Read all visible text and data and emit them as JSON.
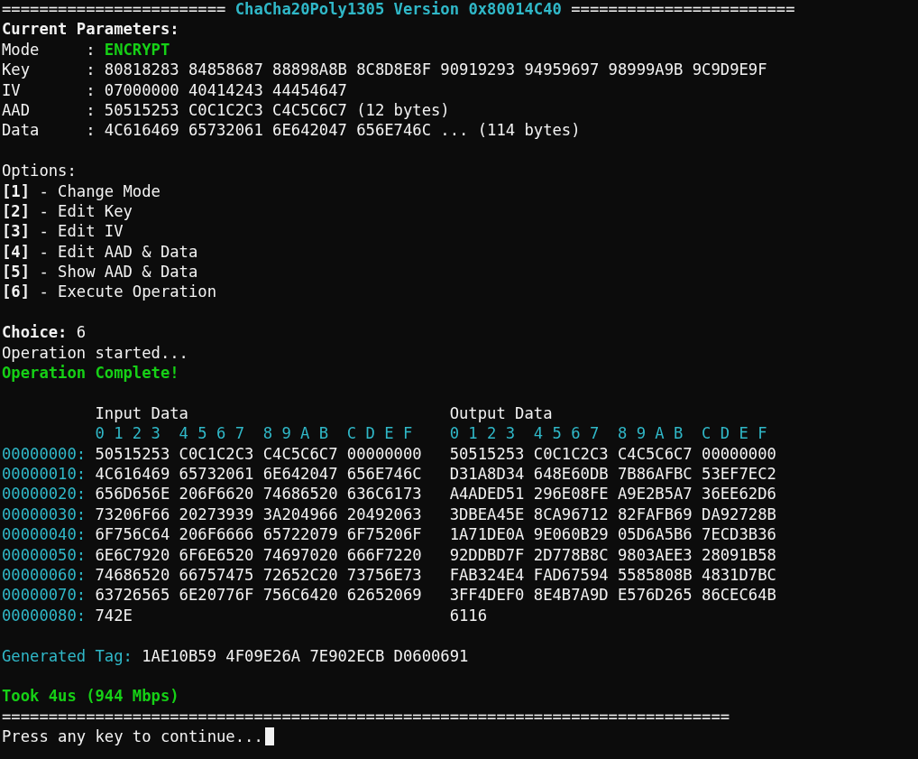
{
  "header": {
    "rule_left": "========================",
    "title": "ChaCha20Poly1305 Version 0x80014C40",
    "rule_right": "========================"
  },
  "parameters": {
    "heading": "Current Parameters:",
    "fields": [
      {
        "label": "Mode",
        "colon": ":",
        "value": "ENCRYPT",
        "kind": "mode"
      },
      {
        "label": "Key",
        "colon": ":",
        "value": "80818283 84858687 88898A8B 8C8D8E8F 90919293 94959697 98999A9B 9C9D9E9F",
        "kind": "plain"
      },
      {
        "label": "IV",
        "colon": ":",
        "value": "07000000 40414243 44454647",
        "kind": "plain"
      },
      {
        "label": "AAD",
        "colon": ":",
        "value": "50515253 C0C1C2C3 C4C5C6C7 (12 bytes)",
        "kind": "plain"
      },
      {
        "label": "Data",
        "colon": ":",
        "value": "4C616469 65732061 6E642047 656E746C ... (114 bytes)",
        "kind": "plain"
      }
    ]
  },
  "options": {
    "heading": "Options:",
    "items": [
      {
        "key": "[1]",
        "label": "- Change Mode"
      },
      {
        "key": "[2]",
        "label": "- Edit Key"
      },
      {
        "key": "[3]",
        "label": "- Edit IV"
      },
      {
        "key": "[4]",
        "label": "- Edit AAD & Data"
      },
      {
        "key": "[5]",
        "label": "- Show AAD & Data"
      },
      {
        "key": "[6]",
        "label": "- Execute Operation"
      }
    ]
  },
  "choice": {
    "label": "Choice:",
    "value": "6"
  },
  "messages": [
    {
      "text": "Operation started...",
      "kind": "info"
    },
    {
      "text": "Operation Complete!",
      "kind": "success"
    }
  ],
  "hex_dump": {
    "input_title": "Input Data",
    "output_title": "Output Data",
    "input_columns": "0 1 2 3  4 5 6 7  8 9 A B  C D E F",
    "output_columns": "0 1 2 3  4 5 6 7  8 9 A B  C D E F",
    "rows": [
      {
        "offset": "00000000:",
        "input": "50515253 C0C1C2C3 C4C5C6C7 00000000",
        "output": "50515253 C0C1C2C3 C4C5C6C7 00000000"
      },
      {
        "offset": "00000010:",
        "input": "4C616469 65732061 6E642047 656E746C",
        "output": "D31A8D34 648E60DB 7B86AFBC 53EF7EC2"
      },
      {
        "offset": "00000020:",
        "input": "656D656E 206F6620 74686520 636C6173",
        "output": "A4ADED51 296E08FE A9E2B5A7 36EE62D6"
      },
      {
        "offset": "00000030:",
        "input": "73206F66 20273939 3A204966 20492063",
        "output": "3DBEA45E 8CA96712 82FAFB69 DA92728B"
      },
      {
        "offset": "00000040:",
        "input": "6F756C64 206F6666 65722079 6F75206F",
        "output": "1A71DE0A 9E060B29 05D6A5B6 7ECD3B36"
      },
      {
        "offset": "00000050:",
        "input": "6E6C7920 6F6E6520 74697020 666F7220",
        "output": "92DDBD7F 2D778B8C 9803AEE3 28091B58"
      },
      {
        "offset": "00000060:",
        "input": "74686520 66757475 72652C20 73756E73",
        "output": "FAB324E4 FAD67594 5585808B 4831D7BC"
      },
      {
        "offset": "00000070:",
        "input": "63726565 6E20776F 756C6420 62652069",
        "output": "3FF4DEF0 8E4B7A9D E576D265 86CEC64B"
      },
      {
        "offset": "00000080:",
        "input": "742E",
        "output": "6116"
      }
    ]
  },
  "tag": {
    "label": "Generated Tag:",
    "value": "1AE10B59 4F09E26A 7E902ECB D0600691"
  },
  "timing": "Took 4us (944 Mbps)",
  "footer_rule": "==============================================================================",
  "prompt": "Press any key to continue..."
}
